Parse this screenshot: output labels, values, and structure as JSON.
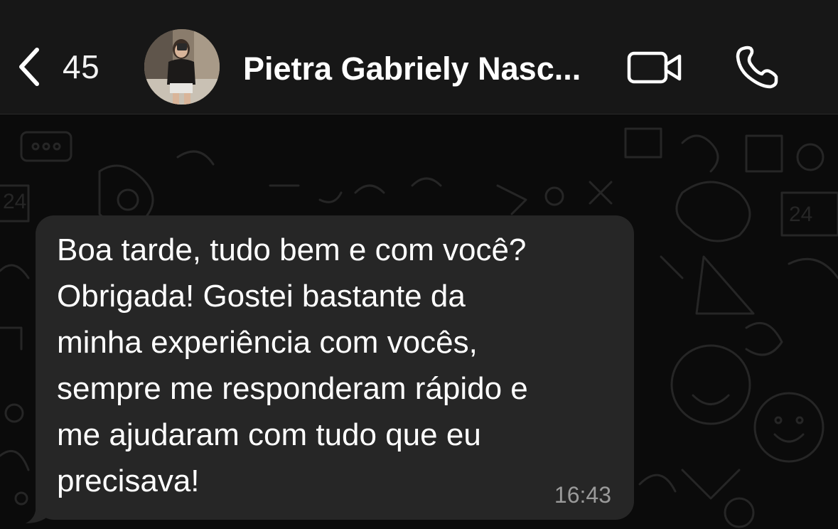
{
  "header": {
    "back_count": "45",
    "contact_name": "Pietra Gabriely Nasc...",
    "avatar_icon": "profile-photo",
    "video_icon": "video-camera-icon",
    "call_icon": "phone-icon"
  },
  "message": {
    "text": "Boa tarde, tudo bem e com você?\nObrigada! Gostei bastante da\nminha experiência com vocês,\nsempre me responderam rápido e\nme ajudaram com tudo que eu\nprecisava!",
    "time": "16:43"
  },
  "colors": {
    "header_bg": "#171717",
    "chat_bg": "#0b0b0b",
    "bubble_bg": "#262626",
    "text": "#ffffff",
    "time": "#9a9a9a"
  }
}
